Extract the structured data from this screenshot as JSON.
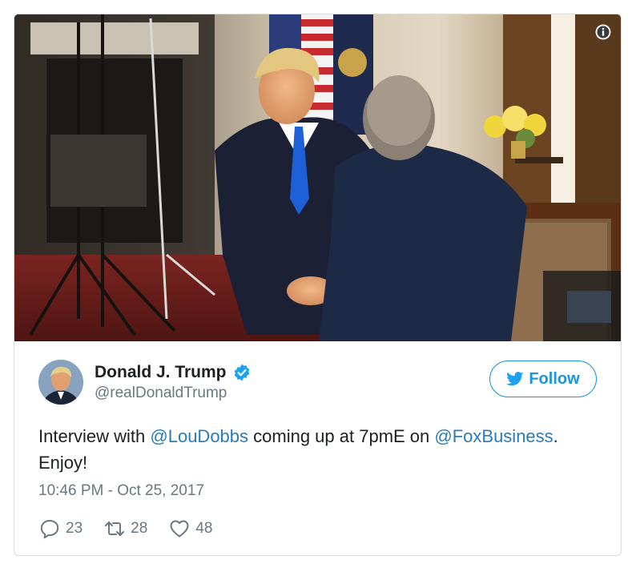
{
  "author": {
    "display_name": "Donald J. Trump",
    "handle": "@realDonaldTrump",
    "verified": true
  },
  "follow_button": {
    "label": "Follow"
  },
  "tweet": {
    "text_before": "Interview with ",
    "mention_1": "@LouDobbs",
    "text_middle": " coming up at 7pmE on ",
    "mention_2": "@FoxBusiness",
    "text_after": ". Enjoy!",
    "timestamp": "10:46 PM - Oct 25, 2017"
  },
  "stats": {
    "replies": "23",
    "retweets": "28",
    "likes": "48"
  },
  "icons": {
    "info": "info-icon",
    "verified": "verified-badge-icon",
    "bird": "twitter-bird-icon",
    "reply": "reply-icon",
    "retweet": "retweet-icon",
    "like": "heart-icon"
  },
  "colors": {
    "accent": "#1b95e0",
    "link": "#2b7bb9",
    "text": "#1c2022",
    "muted": "#697882"
  }
}
